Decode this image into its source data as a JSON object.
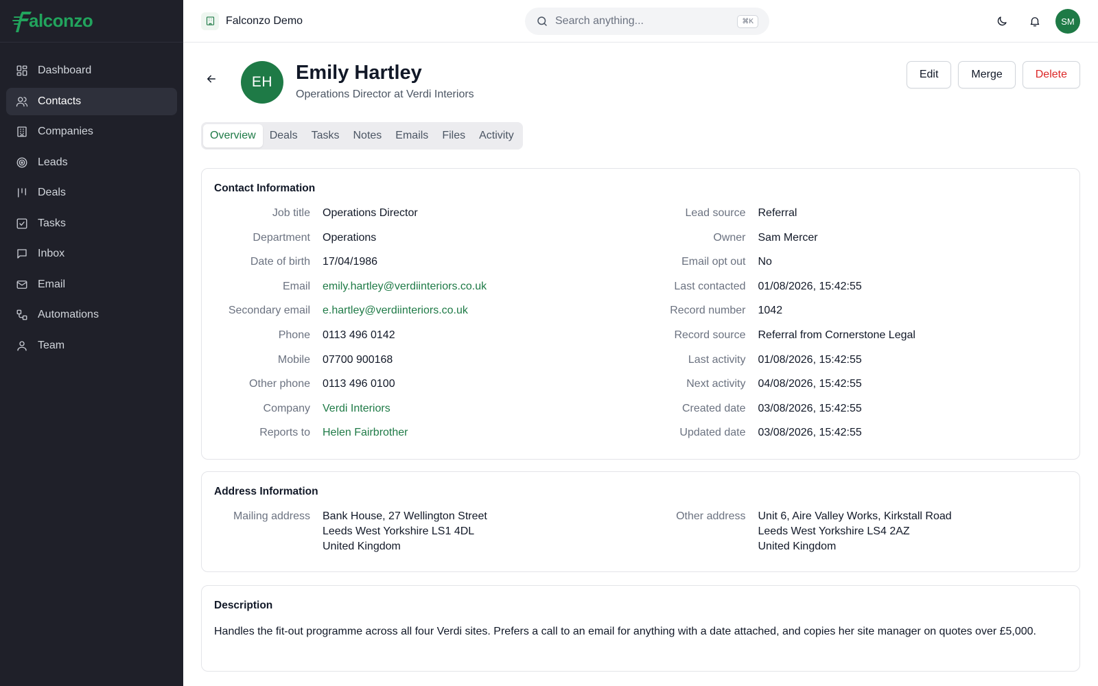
{
  "brand": {
    "logo_text": "alconzo",
    "accent": "#1e7a46"
  },
  "sidebar": {
    "items": [
      {
        "label": "Dashboard",
        "icon": "dashboard-icon"
      },
      {
        "label": "Contacts",
        "icon": "contacts-icon",
        "active": true
      },
      {
        "label": "Companies",
        "icon": "building-icon"
      },
      {
        "label": "Leads",
        "icon": "target-icon"
      },
      {
        "label": "Deals",
        "icon": "kanban-icon"
      },
      {
        "label": "Tasks",
        "icon": "checkbox-icon"
      },
      {
        "label": "Inbox",
        "icon": "message-icon"
      },
      {
        "label": "Email",
        "icon": "mail-icon"
      },
      {
        "label": "Automations",
        "icon": "workflow-icon"
      },
      {
        "label": "Team",
        "icon": "user-icon"
      }
    ]
  },
  "topbar": {
    "workspace_name": "Falconzo Demo",
    "search_placeholder": "Search anything...",
    "shortcut": "⌘K",
    "user_initials": "SM"
  },
  "contact": {
    "initials": "EH",
    "name": "Emily Hartley",
    "subtitle": "Operations Director at Verdi Interiors"
  },
  "actions": {
    "edit": "Edit",
    "merge": "Merge",
    "delete": "Delete"
  },
  "tabs": [
    "Overview",
    "Deals",
    "Tasks",
    "Notes",
    "Emails",
    "Files",
    "Activity"
  ],
  "contact_info": {
    "title": "Contact Information",
    "left": [
      {
        "label": "Job title",
        "value": "Operations Director"
      },
      {
        "label": "Department",
        "value": "Operations"
      },
      {
        "label": "Date of birth",
        "value": "17/04/1986"
      },
      {
        "label": "Email",
        "value": "emily.hartley@verdiinteriors.co.uk",
        "link": true
      },
      {
        "label": "Secondary email",
        "value": "e.hartley@verdiinteriors.co.uk",
        "link": true
      },
      {
        "label": "Phone",
        "value": "0113 496 0142"
      },
      {
        "label": "Mobile",
        "value": "07700 900168"
      },
      {
        "label": "Other phone",
        "value": "0113 496 0100"
      },
      {
        "label": "Company",
        "value": "Verdi Interiors",
        "link": true
      },
      {
        "label": "Reports to",
        "value": "Helen Fairbrother",
        "link": true
      }
    ],
    "right": [
      {
        "label": "Lead source",
        "value": "Referral"
      },
      {
        "label": "Owner",
        "value": "Sam Mercer"
      },
      {
        "label": "Email opt out",
        "value": "No"
      },
      {
        "label": "Last contacted",
        "value": "01/08/2026, 15:42:55"
      },
      {
        "label": "Record number",
        "value": "1042"
      },
      {
        "label": "Record source",
        "value": "Referral from Cornerstone Legal"
      },
      {
        "label": "Last activity",
        "value": "01/08/2026, 15:42:55"
      },
      {
        "label": "Next activity",
        "value": "04/08/2026, 15:42:55"
      },
      {
        "label": "Created date",
        "value": "03/08/2026, 15:42:55"
      },
      {
        "label": "Updated date",
        "value": "03/08/2026, 15:42:55"
      }
    ]
  },
  "address_info": {
    "title": "Address Information",
    "mailing_label": "Mailing address",
    "mailing_lines": [
      "Bank House, 27 Wellington Street",
      "Leeds West Yorkshire LS1 4DL",
      "United Kingdom"
    ],
    "other_label": "Other address",
    "other_lines": [
      "Unit 6, Aire Valley Works, Kirkstall Road",
      "Leeds West Yorkshire LS4 2AZ",
      "United Kingdom"
    ]
  },
  "description": {
    "title": "Description",
    "text": "Handles the fit-out programme across all four Verdi sites. Prefers a call to an email for anything with a date attached, and copies her site manager on quotes over £5,000."
  }
}
